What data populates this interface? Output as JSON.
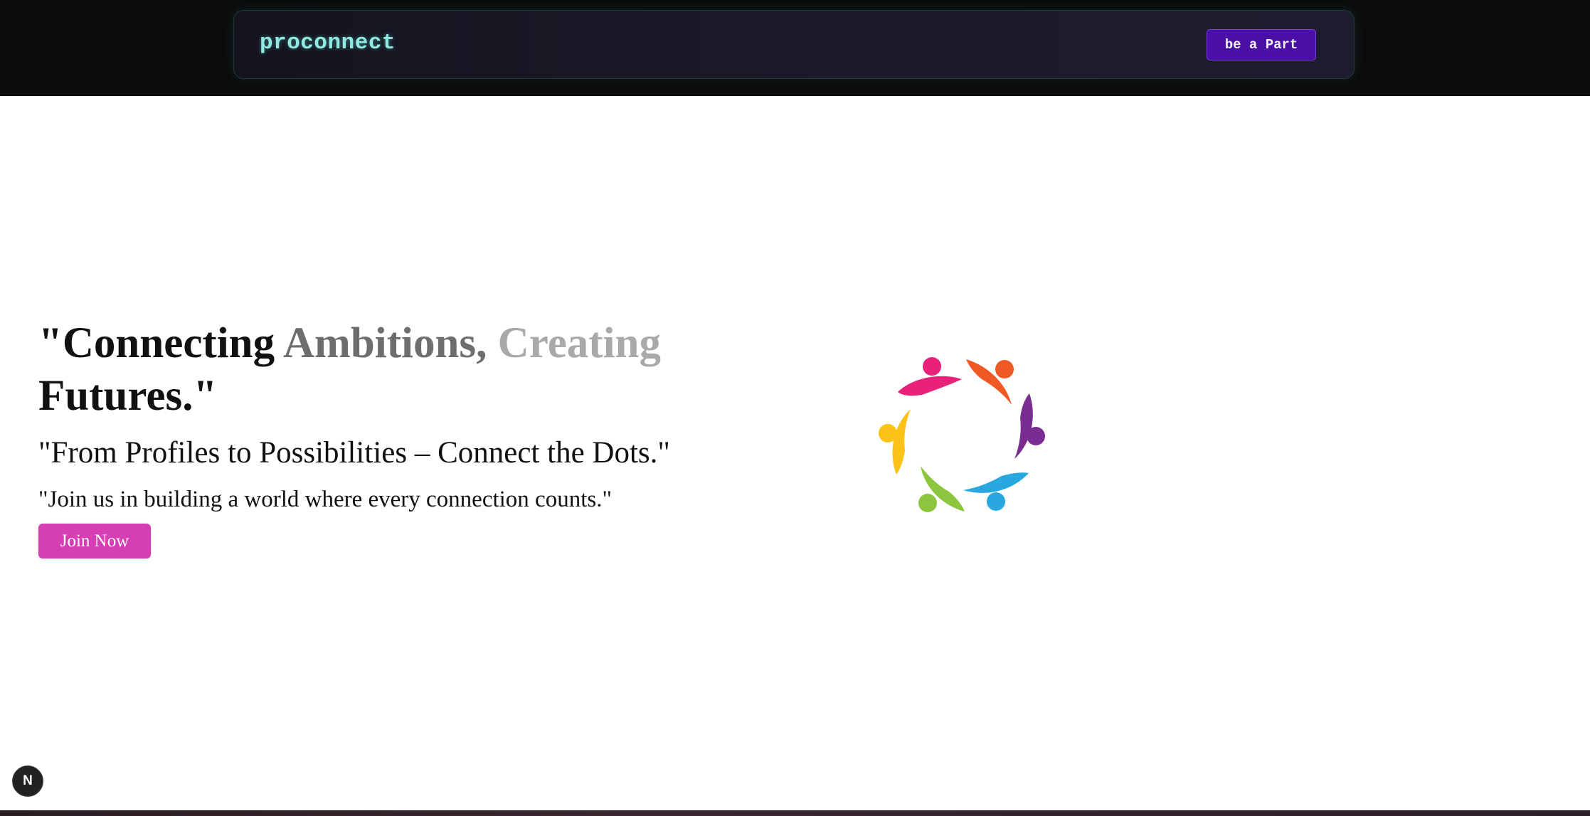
{
  "navbar": {
    "brand": "proconnect",
    "cta_label": "be a Part"
  },
  "hero": {
    "headline_words": [
      "\"Connecting",
      "Ambitions,",
      "Creating",
      "Futures.\""
    ],
    "subtitle": "\"From Profiles to Possibilities – Connect the Dots.\"",
    "tagline": "\"Join us in building a world where every connection counts.\"",
    "join_label": "Join Now"
  },
  "badge": {
    "label": "N"
  },
  "logo": {
    "icon": "people-circle-logo",
    "colors": [
      "#e8217a",
      "#ef5a24",
      "#7a2d91",
      "#29a8e0",
      "#8cc63f",
      "#fbc218"
    ]
  },
  "colors": {
    "brand_text": "#8fe9e1",
    "cta_bg": "#4a0fa6",
    "join_bg": "#d63fb4",
    "nav_bg": "#0b0b0c"
  }
}
